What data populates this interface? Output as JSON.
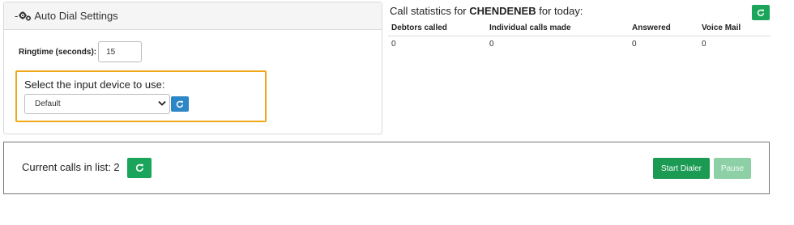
{
  "settings": {
    "dash": "-",
    "title": "Auto Dial Settings",
    "ringtime_label": "Ringtime (seconds):",
    "ringtime_value": "15",
    "device_label": "Select the input device to use:",
    "device_selected": "Default"
  },
  "stats": {
    "title_prefix": "Call statistics for",
    "agent": "CHENDENEB",
    "title_suffix": "for today:",
    "headers": [
      "Debtors called",
      "Individual calls made",
      "Answered",
      "Voice Mail"
    ],
    "values": [
      "0",
      "0",
      "0",
      "0"
    ]
  },
  "calls": {
    "label": "Current calls in list: 2",
    "start_label": "Start Dialer",
    "pause_label": "Pause"
  },
  "colors": {
    "refresh_green": "#1aa55a",
    "refresh_blue": "#2d86c6",
    "highlight_orange": "#f0a818",
    "start_green": "#1a9a52",
    "pause_disabled": "#8ed0a6"
  },
  "icons": {
    "settings": "gears-icon",
    "refresh": "refresh-icon",
    "dropdown": "chevron-down-icon"
  }
}
